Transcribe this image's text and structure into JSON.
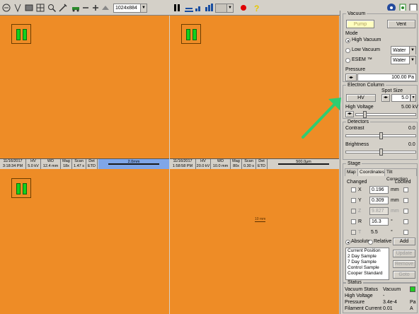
{
  "toolbar": {
    "resolution": "1024x884",
    "colors": {
      "record": "#e00000",
      "help": "#e8c800"
    }
  },
  "quads": [
    {
      "databar": {
        "date": "11/16/2017",
        "time": "3:18:34 PM",
        "hv_label": "HV",
        "hv": "5.0 kV",
        "wd_label": "WD",
        "wd": "12.4 mm",
        "mag_label": "Mag",
        "mag": "18x",
        "scan_label": "Scan",
        "scan": "1.47 s",
        "det_label": "Det",
        "det": "ETD",
        "scalebar": "2.0mm"
      }
    },
    {
      "databar": {
        "date": "11/16/2017",
        "time": "1:58:58 PM",
        "hv_label": "HV",
        "hv": "20.0 kV",
        "wd_label": "WD",
        "wd": "10.0 mm",
        "mag_label": "Mag",
        "mag": "80x",
        "scan_label": "Scan",
        "scan": "0.30 s",
        "det_label": "Det",
        "det": "ETD",
        "scalebar": "500.0µm"
      }
    },
    {
      "databar": null
    },
    {
      "databar": null,
      "scale_label": "10 mm"
    }
  ],
  "panel": {
    "vacuum": {
      "title": "Vacuum",
      "pump": "Pump",
      "vent": "Vent",
      "mode_title": "Mode",
      "high_vacuum": "High Vacuum",
      "low_vacuum": "Low Vacuum",
      "low_gas": "Water",
      "esem": "ESEM ™",
      "esem_gas": "Water",
      "pressure_title": "Pressure",
      "pressure": "100.00 Pa"
    },
    "column": {
      "title": "Electron Column",
      "spot_title": "Spot Size",
      "hv_button": "HV",
      "spot": "5.0",
      "hv_label": "High Voltage",
      "hv_value": "5.00 kV"
    },
    "detectors": {
      "title": "Detectors",
      "contrast": "Contrast",
      "contrast_value": "0.0",
      "brightness": "Brightness",
      "brightness_value": "0.0"
    },
    "stage": {
      "title": "Stage",
      "tabs": [
        "Map",
        "Coordinates",
        "Tilt Correction"
      ],
      "changed": "Changed",
      "locked": "Locked",
      "x": "0.196",
      "y": "0.309",
      "z": "9.827",
      "r": "16.3",
      "t": "5.5",
      "unit_mm": "mm",
      "unit_deg": "°",
      "absolute": "Absolute",
      "relative": "Relative",
      "add": "Add",
      "positions": [
        "Current Position",
        "2 Day Sample",
        "7 Day Sample",
        "Control Sample",
        "Cooper Standard"
      ],
      "update": "Update",
      "remove": "Remove",
      "goto": "Goto"
    },
    "status": {
      "title": "Status",
      "rows": [
        {
          "label": "Vacuum Status",
          "value": "Vacuum",
          "unit": ""
        },
        {
          "label": "High Voltage",
          "value": "-",
          "unit": ""
        },
        {
          "label": "Pressure",
          "value": "3.4e-4",
          "unit": "Pa"
        },
        {
          "label": "Filament Current",
          "value": "0.01",
          "unit": "A"
        }
      ],
      "ok_color": "#22cc22"
    }
  },
  "annotation": {
    "arrow_color": "#2ecc71"
  }
}
